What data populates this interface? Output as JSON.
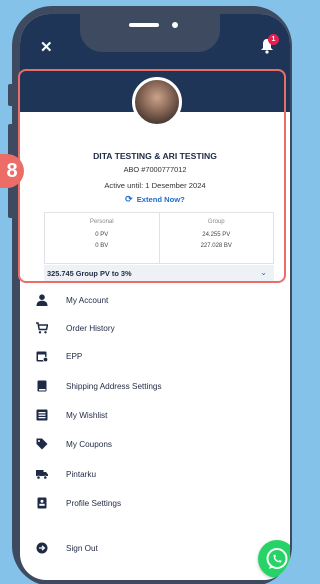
{
  "notification": {
    "count": "1"
  },
  "profile": {
    "name": "DITA TESTING & ARI TESTING",
    "abo": "ABO #7000777012",
    "active_until": "Active until:  1 Desember 2024",
    "extend_label": "Extend Now?"
  },
  "pv_table": {
    "personal_header": "Personal",
    "group_header": "Group",
    "personal_pv": "0 PV",
    "personal_bv": "0 BV",
    "group_pv": "24.255 PV",
    "group_bv": "227.028 BV"
  },
  "pv_progress": {
    "label": "325.745 Group PV to 3%"
  },
  "menu": {
    "items": [
      {
        "label": "My Account",
        "icon": "person-icon"
      },
      {
        "label": "Order History",
        "icon": "cart-icon"
      },
      {
        "label": "EPP",
        "icon": "calendar-icon"
      },
      {
        "label": "Shipping Address Settings",
        "icon": "book-icon"
      },
      {
        "label": "My Wishlist",
        "icon": "list-icon"
      },
      {
        "label": "My Coupons",
        "icon": "tag-icon"
      },
      {
        "label": "Pintarku",
        "icon": "truck-icon"
      },
      {
        "label": "Profile Settings",
        "icon": "id-card-icon"
      },
      {
        "label": "Sign Out",
        "icon": "sign-out-icon"
      }
    ]
  },
  "annotation": {
    "step": "8"
  },
  "colors": {
    "header": "#1e3557",
    "accent": "#1e6fc8",
    "highlight": "#ec6d67",
    "background": "#84c2ea",
    "phone_frame": "#3d4a60"
  }
}
